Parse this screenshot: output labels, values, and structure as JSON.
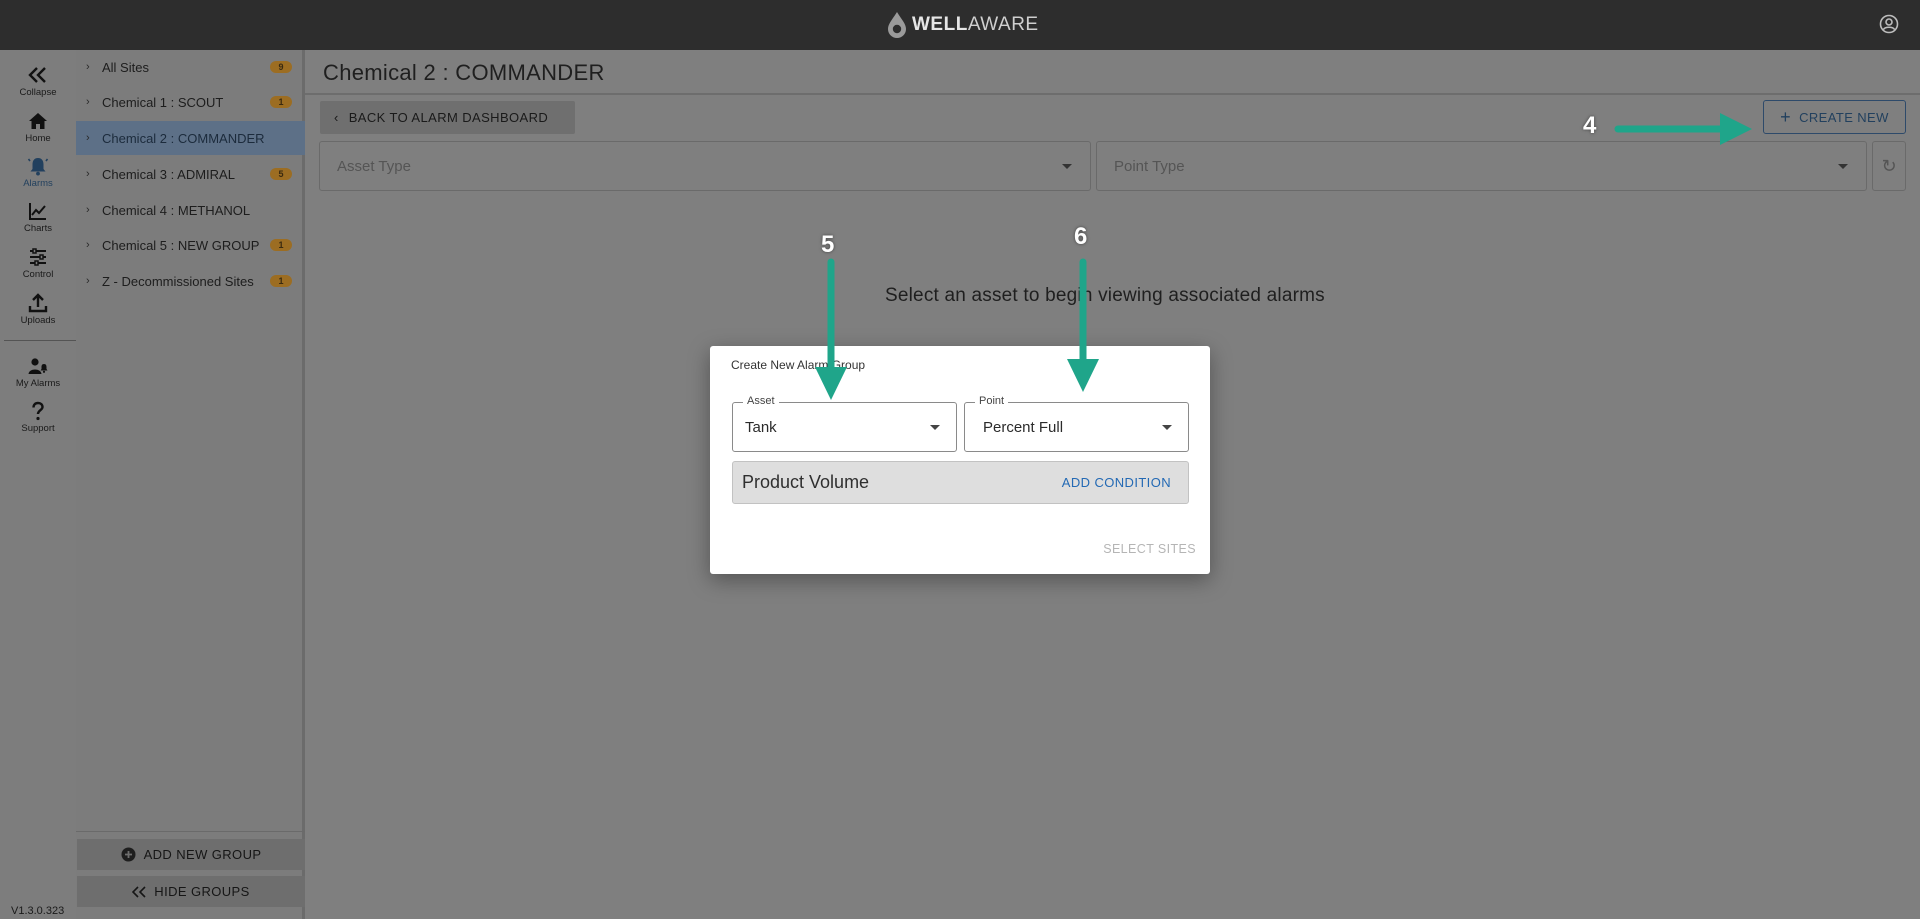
{
  "header": {
    "logo_part1": "WELL",
    "logo_part2": "AWARE"
  },
  "rail": {
    "collapse": "Collapse",
    "home": "Home",
    "alarms": "Alarms",
    "charts": "Charts",
    "control": "Control",
    "uploads": "Uploads",
    "my_alarms": "My Alarms",
    "support": "Support",
    "version": "V1.3.0.323"
  },
  "groups": {
    "items": [
      {
        "label": "All Sites",
        "count": "9"
      },
      {
        "label": "Chemical 1 : SCOUT",
        "count": "1"
      },
      {
        "label": "Chemical 2 : COMMANDER",
        "count": ""
      },
      {
        "label": "Chemical 3 : ADMIRAL",
        "count": "5"
      },
      {
        "label": "Chemical 4 : METHANOL",
        "count": ""
      },
      {
        "label": "Chemical 5 : NEW GROUP",
        "count": "1"
      },
      {
        "label": "Z - Decommissioned Sites",
        "count": "1"
      }
    ],
    "add_new_group": "ADD NEW GROUP",
    "hide_groups": "HIDE GROUPS"
  },
  "main": {
    "title": "Chemical 2 : COMMANDER",
    "back_button": "BACK TO ALARM DASHBOARD",
    "create_new": "CREATE NEW",
    "asset_type_placeholder": "Asset Type",
    "point_type_placeholder": "Point Type",
    "empty_message": "Select an asset to begin viewing associated alarms"
  },
  "dialog": {
    "title": "Create New Alarm Group",
    "asset_label": "Asset",
    "asset_value": "Tank",
    "point_label": "Point",
    "point_value": "Percent Full",
    "condition_name": "Product Volume",
    "add_condition": "ADD CONDITION",
    "select_sites": "SELECT SITES"
  },
  "annotations": {
    "step4": "4",
    "step5": "5",
    "step6": "6",
    "arrow_color": "#1fa58a"
  }
}
